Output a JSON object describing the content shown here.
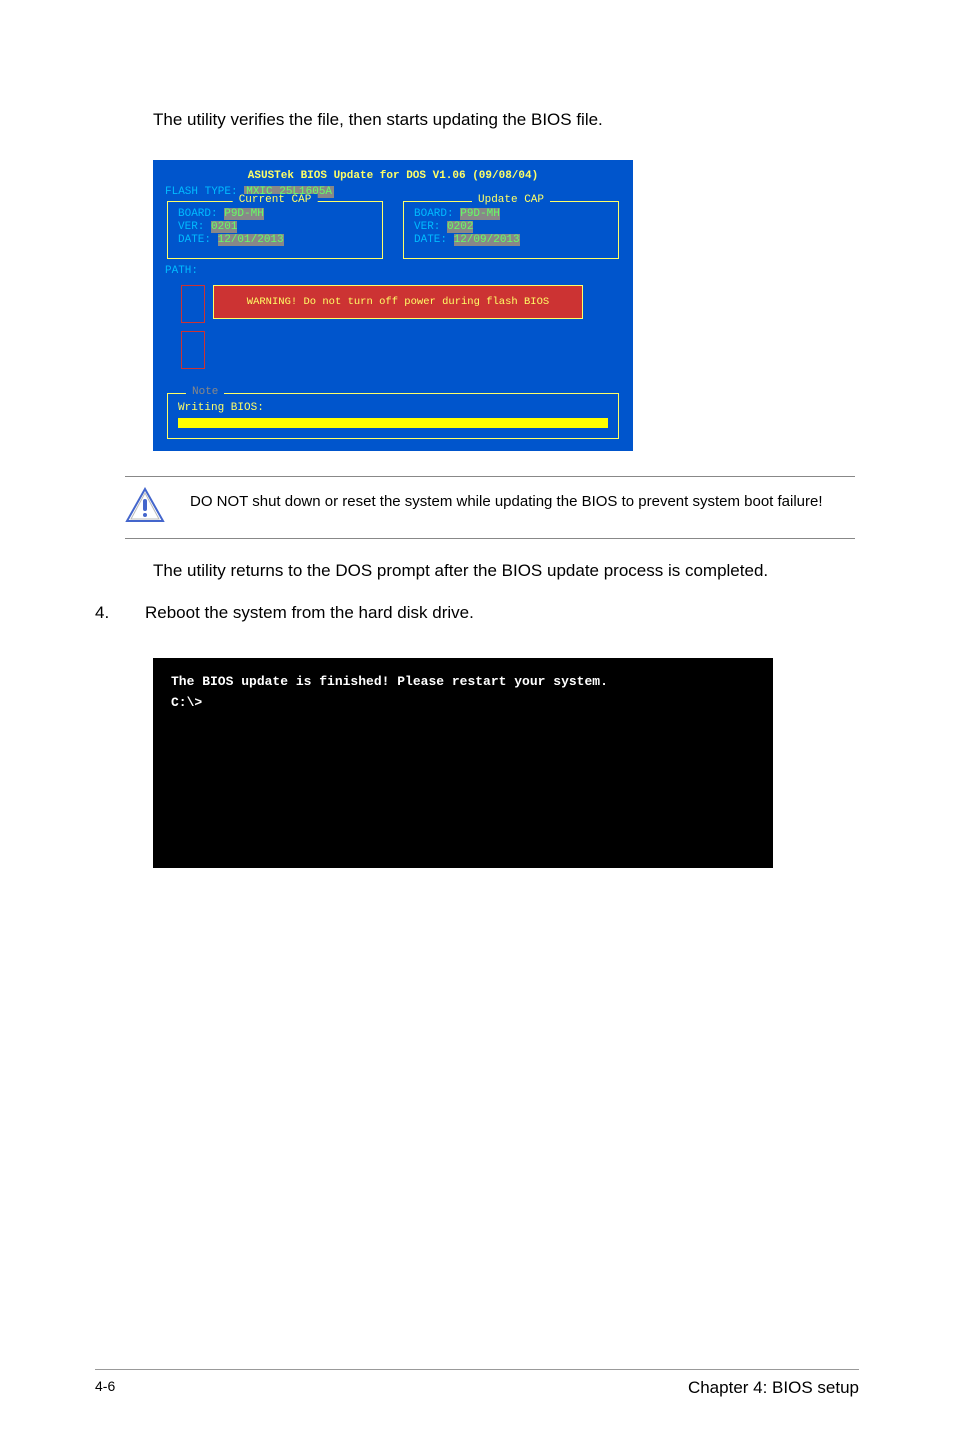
{
  "intro": "The utility verifies the file, then starts updating the BIOS file.",
  "bios": {
    "title": "ASUSTek BIOS Update for DOS V1.06 (09/08/04)",
    "flashTypeLabel": "FLASH TYPE: ",
    "flashTypeValue": "MXIC 25L1605A",
    "currentCap": {
      "legend": "Current CAP",
      "boardLabel": "BOARD: ",
      "boardValue": "P9D-MH",
      "verLabel": "VER: ",
      "verValue": "0201",
      "dateLabel": "DATE: ",
      "dateValue": "12/01/2013"
    },
    "updateCap": {
      "legend": "Update CAP",
      "boardLabel": "BOARD: ",
      "boardValue": "P9D-MH",
      "verLabel": "VER: ",
      "verValue": "0202",
      "dateLabel": "DATE: ",
      "dateValue": "12/09/2013"
    },
    "pathLabel": "PATH:",
    "warning": "WARNING! Do not turn off power during flash BIOS",
    "noteLegend": "Note",
    "writing": "Writing BIOS:"
  },
  "caution": "DO NOT shut down or reset the system while updating the BIOS to prevent system boot failure!",
  "returnText": "The utility returns to the DOS prompt after the BIOS update process is completed.",
  "step": {
    "num": "4.",
    "text": "Reboot the system from the hard disk drive."
  },
  "dos": {
    "line1": "The BIOS update is finished! Please restart your system.",
    "line2": "C:\\>"
  },
  "footer": {
    "page": "4-6",
    "chapter": "Chapter 4: BIOS setup"
  }
}
